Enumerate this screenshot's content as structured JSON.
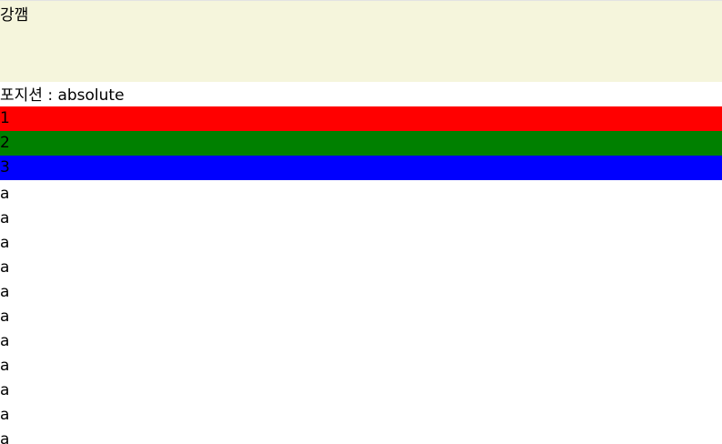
{
  "banner": {
    "text": "강깸",
    "background": "#f5f5dc"
  },
  "position_label": "포지션 : absolute",
  "boxes": [
    {
      "label": "1",
      "color": "#ff0000"
    },
    {
      "label": "2",
      "color": "#008000"
    },
    {
      "label": "3",
      "color": "#0000ff"
    }
  ],
  "filler_lines": [
    "a",
    "a",
    "a",
    "a",
    "a",
    "a",
    "a",
    "a",
    "a",
    "a",
    "a"
  ]
}
